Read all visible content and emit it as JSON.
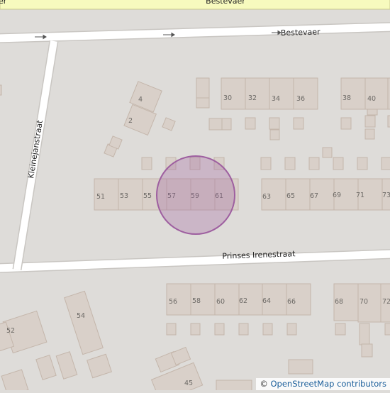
{
  "streets": {
    "top": "Bestevaer",
    "middle": "Bestevaer",
    "vertical": "Kleinejanstraat",
    "bottom": "Prinses Irenestraat",
    "top_left_fragment": "er"
  },
  "house_numbers": {
    "row1": [
      "30",
      "32",
      "34",
      "36",
      "38",
      "40"
    ],
    "row2": [
      "51",
      "53",
      "55",
      "57",
      "59",
      "61",
      "63",
      "65",
      "67",
      "69",
      "71",
      "73"
    ],
    "row3": [
      "56",
      "58",
      "60",
      "62",
      "64",
      "66",
      "68",
      "70",
      "72"
    ],
    "misc": [
      "4",
      "2",
      "54",
      "52",
      "45"
    ]
  },
  "marker": {
    "color": "#9e5fa0"
  },
  "attribution": {
    "symbol": "©",
    "text": "OpenStreetMap contributors"
  }
}
